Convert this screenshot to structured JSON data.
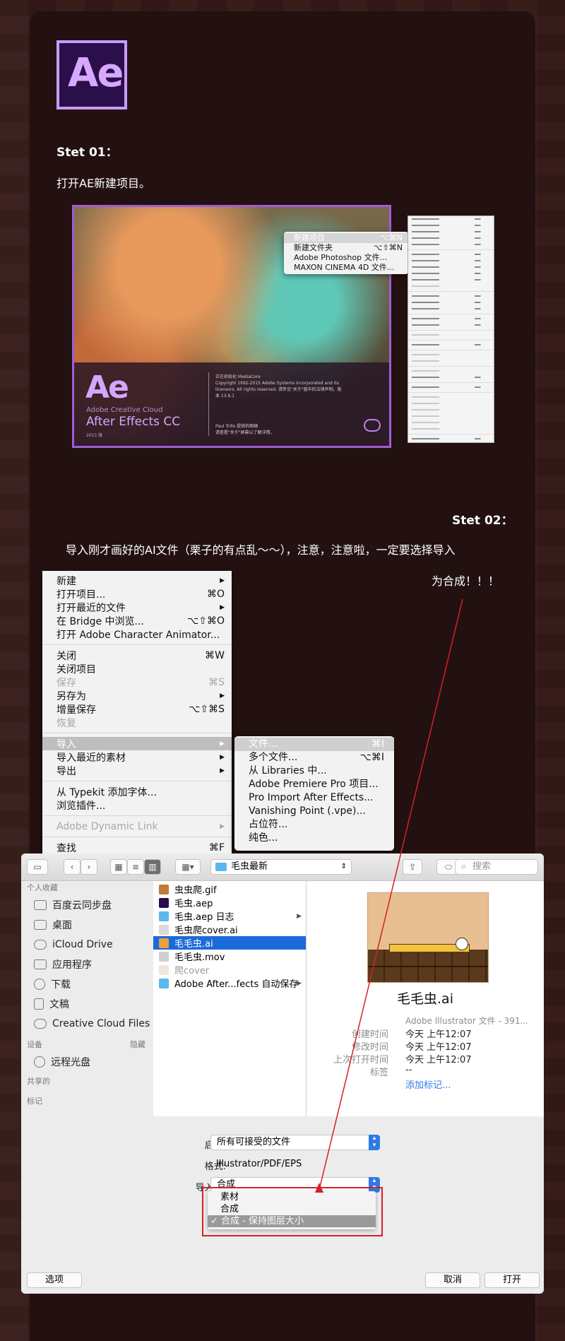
{
  "logo": {
    "text": "Ae"
  },
  "step1": {
    "title": "Stet 01：",
    "text": "打开AE新建项目。"
  },
  "splash": {
    "ae": "Ae",
    "cc": "Adobe Creative Cloud",
    "name": "After Effects CC",
    "year": "2015 版",
    "info": "正在初始化 MediaCore\nCopyright 1992-2015 Adobe Systems Incorporated and its licensors. All rights reserved. 请参见\"关于\"窗中的法律声明。版本 13.6.1",
    "credit": "Paul Trillo 提供的图稿\n请查看\"关于\"屏幕以了解详情。"
  },
  "mini_menu": [
    {
      "label": "新建项目",
      "key": "⌥⌘N",
      "sel": true
    },
    {
      "label": "新建文件夹",
      "key": "⌥⇧⌘N"
    },
    {
      "label": "Adobe Photoshop 文件...",
      "key": ""
    },
    {
      "label": "MAXON CINEMA 4D 文件...",
      "key": ""
    }
  ],
  "step2": {
    "title": "Stet 02：",
    "text1": "导入刚才画好的AI文件（栗子的有点乱～～），注意，注意啦，一定要选择导入",
    "text2": "为合成！！！"
  },
  "file_menu": {
    "items": [
      {
        "label": "新建",
        "key": "▶"
      },
      {
        "label": "打开项目...",
        "key": "⌘O"
      },
      {
        "label": "打开最近的文件",
        "key": "▶"
      },
      {
        "label": "在 Bridge 中浏览...",
        "key": "⌥⇧⌘O"
      },
      {
        "label": "打开 Adobe Character Animator...",
        "key": ""
      },
      {
        "label": "关闭",
        "key": "⌘W"
      },
      {
        "label": "关闭项目",
        "key": ""
      },
      {
        "label": "保存",
        "key": "⌘S"
      },
      {
        "label": "另存为",
        "key": "▶"
      },
      {
        "label": "增量保存",
        "key": "⌥⇧⌘S"
      },
      {
        "label": "恢复",
        "key": ""
      },
      {
        "label": "导入",
        "key": "▶"
      },
      {
        "label": "导入最近的素材",
        "key": "▶"
      },
      {
        "label": "导出",
        "key": "▶"
      },
      {
        "label": "从 Typekit 添加字体...",
        "key": ""
      },
      {
        "label": "浏览插件...",
        "key": ""
      },
      {
        "label": "Adobe Dynamic Link",
        "key": "▶"
      },
      {
        "label": "查找",
        "key": "⌘F"
      }
    ]
  },
  "import_submenu": [
    {
      "label": "文件...",
      "key": "⌘I"
    },
    {
      "label": "多个文件...",
      "key": "⌥⌘I"
    },
    {
      "label": "从 Libraries 中...",
      "key": ""
    },
    {
      "label": "Adobe Premiere Pro 项目...",
      "key": ""
    },
    {
      "label": "Pro Import After Effects...",
      "key": ""
    },
    {
      "label": "Vanishing Point (.vpe)...",
      "key": ""
    },
    {
      "label": "占位符...",
      "key": ""
    },
    {
      "label": "纯色...",
      "key": ""
    }
  ],
  "dialog": {
    "path": "毛虫最新",
    "search_placeholder": "搜索",
    "sidebar_favorites": "个人收藏",
    "favorites": [
      "百度云同步盘",
      "桌面",
      "iCloud Drive",
      "应用程序",
      "下载",
      "文稿",
      "Creative Cloud Files"
    ],
    "devices": "设备",
    "hide": "隐藏",
    "device_items": [
      "远程光盘"
    ],
    "shared": "共享的",
    "tags": "标记",
    "files": [
      {
        "name": "虫虫爬.gif",
        "color": "#c07a3a"
      },
      {
        "name": "毛虫.aep",
        "color": "#2a0f4a"
      },
      {
        "name": "毛虫.aep 日志",
        "color": "#5ab8ee"
      },
      {
        "name": "毛虫爬cover.ai",
        "color": "#d9d9d9"
      },
      {
        "name": "毛毛虫.ai",
        "color": "#e8a040"
      },
      {
        "name": "毛毛虫.mov",
        "color": "#d0d0d0"
      },
      {
        "name": "爬cover",
        "color": "#f0f0f0"
      },
      {
        "name": "Adobe After...fects 自动保存",
        "color": "#5ab8ee"
      }
    ],
    "preview_name": "毛毛虫.ai",
    "kind": "Adobe Illustrator 文件 - 391...",
    "meta": [
      {
        "k": "创建时间",
        "v": "今天 上午12:07"
      },
      {
        "k": "修改时间",
        "v": "今天 上午12:07"
      },
      {
        "k": "上次打开时间",
        "v": "今天 上午12:07"
      },
      {
        "k": "标签",
        "v": "--"
      }
    ],
    "add_tags": "添加标记...",
    "enable_label": "启用:",
    "enable_value": "所有可接受的文件",
    "format_label": "格式:",
    "format_value": "Illustrator/PDF/EPS",
    "import_as_label": "导入为:",
    "import_as_value": "合成",
    "import_options": [
      "素材",
      "合成",
      "✓ 合成 - 保持图层大小"
    ],
    "options_btn": "选项",
    "cancel_btn": "取消",
    "open_btn": "打开"
  }
}
